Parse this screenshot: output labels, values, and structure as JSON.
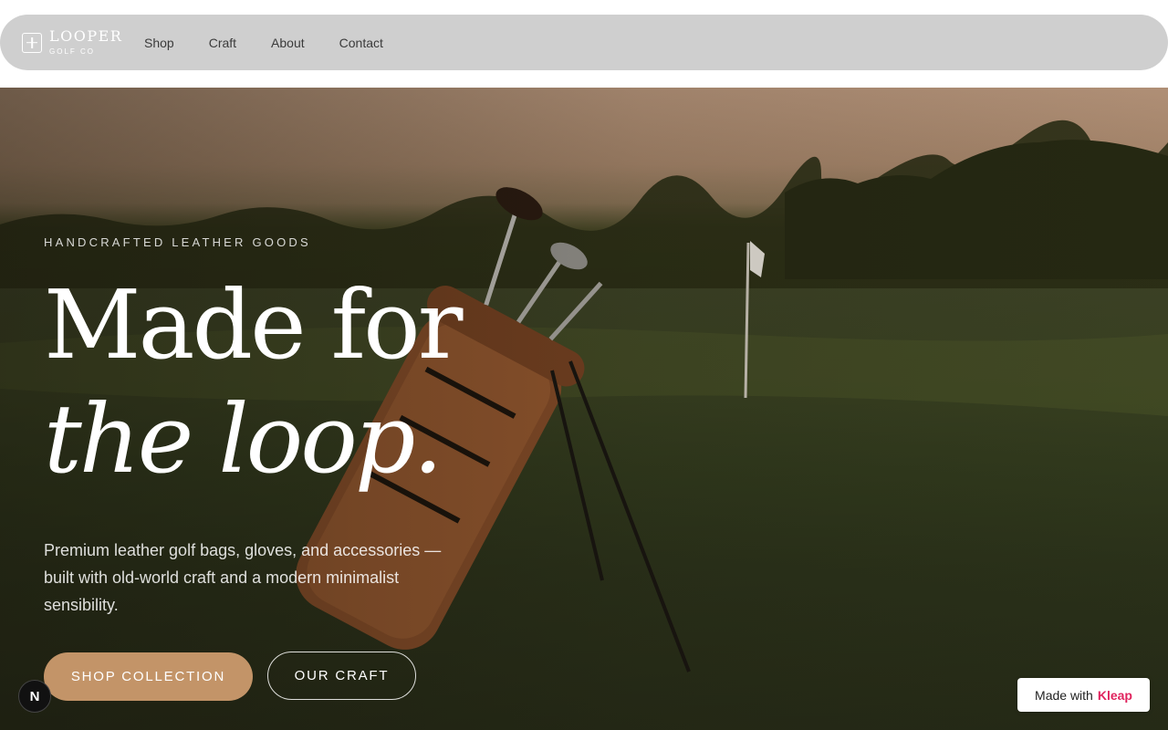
{
  "nav": {
    "logo_name": "LOOPER",
    "logo_sub": "GOLF CO",
    "links": [
      "Shop",
      "Craft",
      "About",
      "Contact"
    ]
  },
  "hero": {
    "eyebrow": "HANDCRAFTED LEATHER GOODS",
    "headline_line1": "Made for",
    "headline_line2": "the loop.",
    "subtext": "Premium leather golf bags, gloves, and accessories — built with old-world craft and a modern minimalist sensibility.",
    "primary_cta": "SHOP COLLECTION",
    "secondary_cta": "OUR CRAFT"
  },
  "badges": {
    "n_badge": "N",
    "made_with": "Made with",
    "brand": "Kleap"
  },
  "colors": {
    "nav_bg": "#cfcfcf",
    "accent": "#c39468",
    "kleap_brand": "#e0245e"
  },
  "icons": [
    "logo-plus-icon",
    "golf-bag-image",
    "flag-icon"
  ]
}
